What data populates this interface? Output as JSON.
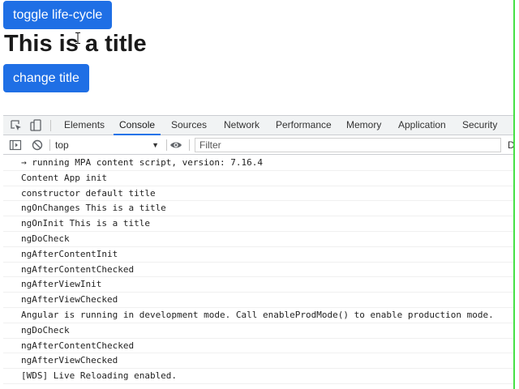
{
  "app": {
    "toggle_button_label": "toggle life-cycle",
    "title": "This is a title",
    "change_button_label": "change title"
  },
  "devtools": {
    "tabs": [
      {
        "label": "Elements"
      },
      {
        "label": "Console"
      },
      {
        "label": "Sources"
      },
      {
        "label": "Network"
      },
      {
        "label": "Performance"
      },
      {
        "label": "Memory"
      },
      {
        "label": "Application"
      },
      {
        "label": "Security"
      }
    ],
    "active_tab": "Console",
    "accent_color": "#1a73e8",
    "toolbar": {
      "context": "top",
      "filter_placeholder": "Filter",
      "trailing_text": "D"
    },
    "console_lines": [
      "→ running MPA content script, version: 7.16.4",
      "Content App init",
      "constructor default title",
      "ngOnChanges This is a title",
      "ngOnInit This is a title",
      "ngDoCheck",
      "ngAfterContentInit",
      "ngAfterContentChecked",
      "ngAfterViewInit",
      "ngAfterViewChecked",
      "Angular is running in development mode. Call enableProdMode() to enable production mode.",
      "ngDoCheck",
      "ngAfterContentChecked",
      "ngAfterViewChecked",
      "[WDS] Live Reloading enabled."
    ]
  },
  "colors": {
    "button_bg": "#1f6fe5",
    "window_edge": "#46e046"
  },
  "icons": [
    "inspect-element-icon",
    "device-toolbar-icon",
    "sidebar-toggle-icon",
    "clear-console-icon",
    "eye-icon",
    "cursor-icon"
  ]
}
